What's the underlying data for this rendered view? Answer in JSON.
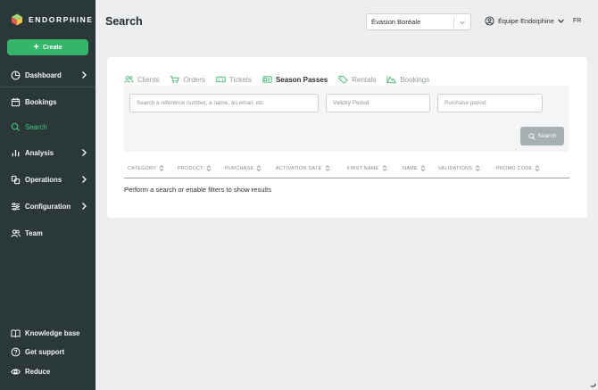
{
  "brand": {
    "name": "ENDORPHINE",
    "accent": "#35b56a",
    "sidebar_bg": "#2b3838"
  },
  "sidebar": {
    "create_label": "Create",
    "items": [
      {
        "label": "Dashboard",
        "icon": "pie-chart-icon",
        "chevron": true
      },
      {
        "label": "Bookings",
        "icon": "calendar-icon",
        "chevron": false
      },
      {
        "label": "Search",
        "icon": "search-icon",
        "chevron": false,
        "active": true
      },
      {
        "label": "Analysis",
        "icon": "bar-chart-icon",
        "chevron": true
      },
      {
        "label": "Operations",
        "icon": "operations-icon",
        "chevron": true
      },
      {
        "label": "Configuration",
        "icon": "sliders-icon",
        "chevron": true
      },
      {
        "label": "Team",
        "icon": "users-icon",
        "chevron": false
      }
    ],
    "footer": [
      {
        "label": "Knowledge base",
        "icon": "book-icon"
      },
      {
        "label": "Get support",
        "icon": "help-icon"
      },
      {
        "label": "Reduce",
        "icon": "eye-icon"
      }
    ]
  },
  "header": {
    "title": "Search",
    "org_select": "Évasion Boréale",
    "team": "Équipe Endorphine",
    "lang": "FR"
  },
  "tabs": [
    {
      "label": "Clients",
      "icon": "users-icon"
    },
    {
      "label": "Orders",
      "icon": "cart-icon"
    },
    {
      "label": "Tickets",
      "icon": "ticket-icon"
    },
    {
      "label": "Season Passes",
      "icon": "pass-icon",
      "active": true
    },
    {
      "label": "Rentals",
      "icon": "tag-icon"
    },
    {
      "label": "Bookings",
      "icon": "mountain-icon"
    }
  ],
  "filters": {
    "query_placeholder": "Search a reference number, a name, an email, etc.",
    "validity_placeholder": "Validity Period",
    "purchase_placeholder": "Purchase period",
    "search_label": "Search"
  },
  "table": {
    "columns": [
      "CATEGORY",
      "PRODUCT",
      "PURCHASE",
      "ACTIVATION DATE",
      "FIRST NAME",
      "NAME",
      "VALIDATIONS",
      "PROMO CODE"
    ],
    "empty_message": "Perform a search or enable filters to show results"
  }
}
